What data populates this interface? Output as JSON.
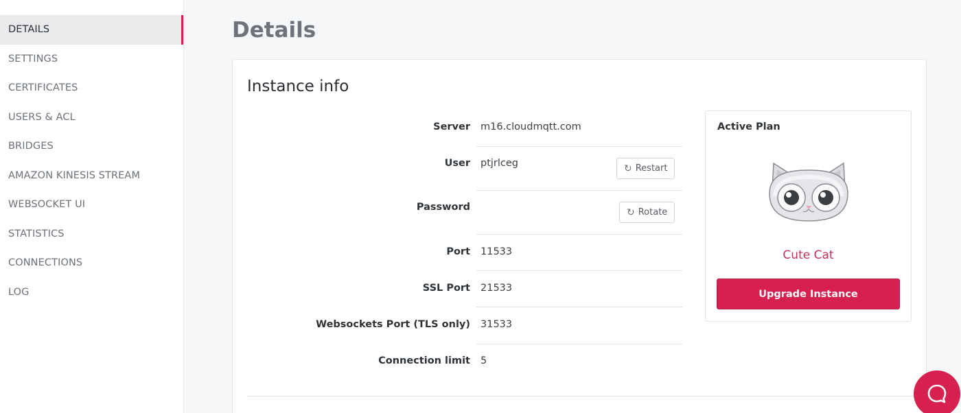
{
  "sidebar": {
    "items": [
      {
        "label": "DETAILS",
        "active": true
      },
      {
        "label": "SETTINGS"
      },
      {
        "label": "CERTIFICATES"
      },
      {
        "label": "USERS & ACL"
      },
      {
        "label": "BRIDGES"
      },
      {
        "label": "AMAZON KINESIS STREAM"
      },
      {
        "label": "WEBSOCKET UI"
      },
      {
        "label": "STATISTICS"
      },
      {
        "label": "CONNECTIONS"
      },
      {
        "label": "LOG"
      }
    ]
  },
  "page": {
    "title": "Details"
  },
  "instance": {
    "title": "Instance info",
    "rows": [
      {
        "label": "Server",
        "value": "m16.cloudmqtt.com"
      },
      {
        "label": "User",
        "value": "ptjrlceg"
      },
      {
        "label": "Password",
        "value": ""
      },
      {
        "label": "Port",
        "value": "11533"
      },
      {
        "label": "SSL Port",
        "value": "21533"
      },
      {
        "label": "Websockets Port (TLS only)",
        "value": "31533"
      },
      {
        "label": "Connection limit",
        "value": "5"
      }
    ],
    "restart_label": "Restart",
    "rotate_label": "Rotate"
  },
  "plan": {
    "heading": "Active Plan",
    "name": "Cute Cat",
    "upgrade_label": "Upgrade Instance",
    "image_icon": "cat-mascot-icon"
  },
  "icons": {
    "refresh": "↻",
    "chat": "chat-bubble-icon"
  },
  "colors": {
    "accent": "#d6204f",
    "plan_name": "#c2305a"
  }
}
